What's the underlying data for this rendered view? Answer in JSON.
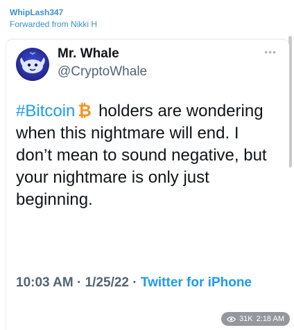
{
  "message": {
    "sender": "WhipLash347",
    "forwarded_from": "Forwarded from Nikki H"
  },
  "tweet": {
    "author_name": "Mr. Whale",
    "author_handle": "@CryptoWhale",
    "more_icon": "more-horizontal-icon",
    "text_hashtag": "#Bitcoin",
    "text_rest": "holders are wondering when this nightmare will end. I don’t mean to sound negative, but your nightmare is only just beginning.",
    "time": "10:03 AM",
    "date": "1/25/22",
    "separator": "·",
    "source": "Twitter for iPhone"
  },
  "stamp": {
    "views": "31K",
    "time": "2:18 AM",
    "icon": "eye-icon"
  },
  "colors": {
    "accent": "#1d9bf0",
    "sender": "#3a90c9",
    "bitcoin": "#f7931a"
  }
}
